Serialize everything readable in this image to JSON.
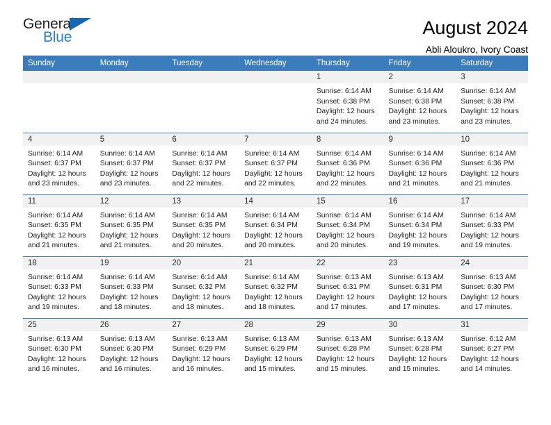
{
  "brand": {
    "name_top": "General",
    "name_bottom": "Blue",
    "accent_dark": "#231f20",
    "accent_blue": "#2a7fc9",
    "triangle_color": "#1567b3"
  },
  "header": {
    "title": "August 2024",
    "subtitle": "Abli Aloukro, Ivory Coast"
  },
  "calendar": {
    "header_bg": "#3b7cbd",
    "header_text_color": "#ffffff",
    "daynum_bg": "#f1f1f1",
    "weekdays": [
      "Sunday",
      "Monday",
      "Tuesday",
      "Wednesday",
      "Thursday",
      "Friday",
      "Saturday"
    ],
    "weeks": [
      [
        {
          "day": "",
          "empty": true,
          "sunrise": "",
          "sunset": "",
          "daylight1": "",
          "daylight2": ""
        },
        {
          "day": "",
          "empty": true,
          "sunrise": "",
          "sunset": "",
          "daylight1": "",
          "daylight2": ""
        },
        {
          "day": "",
          "empty": true,
          "sunrise": "",
          "sunset": "",
          "daylight1": "",
          "daylight2": ""
        },
        {
          "day": "",
          "empty": true,
          "sunrise": "",
          "sunset": "",
          "daylight1": "",
          "daylight2": ""
        },
        {
          "day": "1",
          "empty": false,
          "sunrise": "Sunrise: 6:14 AM",
          "sunset": "Sunset: 6:38 PM",
          "daylight1": "Daylight: 12 hours",
          "daylight2": "and 24 minutes."
        },
        {
          "day": "2",
          "empty": false,
          "sunrise": "Sunrise: 6:14 AM",
          "sunset": "Sunset: 6:38 PM",
          "daylight1": "Daylight: 12 hours",
          "daylight2": "and 23 minutes."
        },
        {
          "day": "3",
          "empty": false,
          "sunrise": "Sunrise: 6:14 AM",
          "sunset": "Sunset: 6:38 PM",
          "daylight1": "Daylight: 12 hours",
          "daylight2": "and 23 minutes."
        }
      ],
      [
        {
          "day": "4",
          "empty": false,
          "sunrise": "Sunrise: 6:14 AM",
          "sunset": "Sunset: 6:37 PM",
          "daylight1": "Daylight: 12 hours",
          "daylight2": "and 23 minutes."
        },
        {
          "day": "5",
          "empty": false,
          "sunrise": "Sunrise: 6:14 AM",
          "sunset": "Sunset: 6:37 PM",
          "daylight1": "Daylight: 12 hours",
          "daylight2": "and 23 minutes."
        },
        {
          "day": "6",
          "empty": false,
          "sunrise": "Sunrise: 6:14 AM",
          "sunset": "Sunset: 6:37 PM",
          "daylight1": "Daylight: 12 hours",
          "daylight2": "and 22 minutes."
        },
        {
          "day": "7",
          "empty": false,
          "sunrise": "Sunrise: 6:14 AM",
          "sunset": "Sunset: 6:37 PM",
          "daylight1": "Daylight: 12 hours",
          "daylight2": "and 22 minutes."
        },
        {
          "day": "8",
          "empty": false,
          "sunrise": "Sunrise: 6:14 AM",
          "sunset": "Sunset: 6:36 PM",
          "daylight1": "Daylight: 12 hours",
          "daylight2": "and 22 minutes."
        },
        {
          "day": "9",
          "empty": false,
          "sunrise": "Sunrise: 6:14 AM",
          "sunset": "Sunset: 6:36 PM",
          "daylight1": "Daylight: 12 hours",
          "daylight2": "and 21 minutes."
        },
        {
          "day": "10",
          "empty": false,
          "sunrise": "Sunrise: 6:14 AM",
          "sunset": "Sunset: 6:36 PM",
          "daylight1": "Daylight: 12 hours",
          "daylight2": "and 21 minutes."
        }
      ],
      [
        {
          "day": "11",
          "empty": false,
          "sunrise": "Sunrise: 6:14 AM",
          "sunset": "Sunset: 6:35 PM",
          "daylight1": "Daylight: 12 hours",
          "daylight2": "and 21 minutes."
        },
        {
          "day": "12",
          "empty": false,
          "sunrise": "Sunrise: 6:14 AM",
          "sunset": "Sunset: 6:35 PM",
          "daylight1": "Daylight: 12 hours",
          "daylight2": "and 21 minutes."
        },
        {
          "day": "13",
          "empty": false,
          "sunrise": "Sunrise: 6:14 AM",
          "sunset": "Sunset: 6:35 PM",
          "daylight1": "Daylight: 12 hours",
          "daylight2": "and 20 minutes."
        },
        {
          "day": "14",
          "empty": false,
          "sunrise": "Sunrise: 6:14 AM",
          "sunset": "Sunset: 6:34 PM",
          "daylight1": "Daylight: 12 hours",
          "daylight2": "and 20 minutes."
        },
        {
          "day": "15",
          "empty": false,
          "sunrise": "Sunrise: 6:14 AM",
          "sunset": "Sunset: 6:34 PM",
          "daylight1": "Daylight: 12 hours",
          "daylight2": "and 20 minutes."
        },
        {
          "day": "16",
          "empty": false,
          "sunrise": "Sunrise: 6:14 AM",
          "sunset": "Sunset: 6:34 PM",
          "daylight1": "Daylight: 12 hours",
          "daylight2": "and 19 minutes."
        },
        {
          "day": "17",
          "empty": false,
          "sunrise": "Sunrise: 6:14 AM",
          "sunset": "Sunset: 6:33 PM",
          "daylight1": "Daylight: 12 hours",
          "daylight2": "and 19 minutes."
        }
      ],
      [
        {
          "day": "18",
          "empty": false,
          "sunrise": "Sunrise: 6:14 AM",
          "sunset": "Sunset: 6:33 PM",
          "daylight1": "Daylight: 12 hours",
          "daylight2": "and 19 minutes."
        },
        {
          "day": "19",
          "empty": false,
          "sunrise": "Sunrise: 6:14 AM",
          "sunset": "Sunset: 6:33 PM",
          "daylight1": "Daylight: 12 hours",
          "daylight2": "and 18 minutes."
        },
        {
          "day": "20",
          "empty": false,
          "sunrise": "Sunrise: 6:14 AM",
          "sunset": "Sunset: 6:32 PM",
          "daylight1": "Daylight: 12 hours",
          "daylight2": "and 18 minutes."
        },
        {
          "day": "21",
          "empty": false,
          "sunrise": "Sunrise: 6:14 AM",
          "sunset": "Sunset: 6:32 PM",
          "daylight1": "Daylight: 12 hours",
          "daylight2": "and 18 minutes."
        },
        {
          "day": "22",
          "empty": false,
          "sunrise": "Sunrise: 6:13 AM",
          "sunset": "Sunset: 6:31 PM",
          "daylight1": "Daylight: 12 hours",
          "daylight2": "and 17 minutes."
        },
        {
          "day": "23",
          "empty": false,
          "sunrise": "Sunrise: 6:13 AM",
          "sunset": "Sunset: 6:31 PM",
          "daylight1": "Daylight: 12 hours",
          "daylight2": "and 17 minutes."
        },
        {
          "day": "24",
          "empty": false,
          "sunrise": "Sunrise: 6:13 AM",
          "sunset": "Sunset: 6:30 PM",
          "daylight1": "Daylight: 12 hours",
          "daylight2": "and 17 minutes."
        }
      ],
      [
        {
          "day": "25",
          "empty": false,
          "sunrise": "Sunrise: 6:13 AM",
          "sunset": "Sunset: 6:30 PM",
          "daylight1": "Daylight: 12 hours",
          "daylight2": "and 16 minutes."
        },
        {
          "day": "26",
          "empty": false,
          "sunrise": "Sunrise: 6:13 AM",
          "sunset": "Sunset: 6:30 PM",
          "daylight1": "Daylight: 12 hours",
          "daylight2": "and 16 minutes."
        },
        {
          "day": "27",
          "empty": false,
          "sunrise": "Sunrise: 6:13 AM",
          "sunset": "Sunset: 6:29 PM",
          "daylight1": "Daylight: 12 hours",
          "daylight2": "and 16 minutes."
        },
        {
          "day": "28",
          "empty": false,
          "sunrise": "Sunrise: 6:13 AM",
          "sunset": "Sunset: 6:29 PM",
          "daylight1": "Daylight: 12 hours",
          "daylight2": "and 15 minutes."
        },
        {
          "day": "29",
          "empty": false,
          "sunrise": "Sunrise: 6:13 AM",
          "sunset": "Sunset: 6:28 PM",
          "daylight1": "Daylight: 12 hours",
          "daylight2": "and 15 minutes."
        },
        {
          "day": "30",
          "empty": false,
          "sunrise": "Sunrise: 6:13 AM",
          "sunset": "Sunset: 6:28 PM",
          "daylight1": "Daylight: 12 hours",
          "daylight2": "and 15 minutes."
        },
        {
          "day": "31",
          "empty": false,
          "sunrise": "Sunrise: 6:12 AM",
          "sunset": "Sunset: 6:27 PM",
          "daylight1": "Daylight: 12 hours",
          "daylight2": "and 14 minutes."
        }
      ]
    ]
  }
}
